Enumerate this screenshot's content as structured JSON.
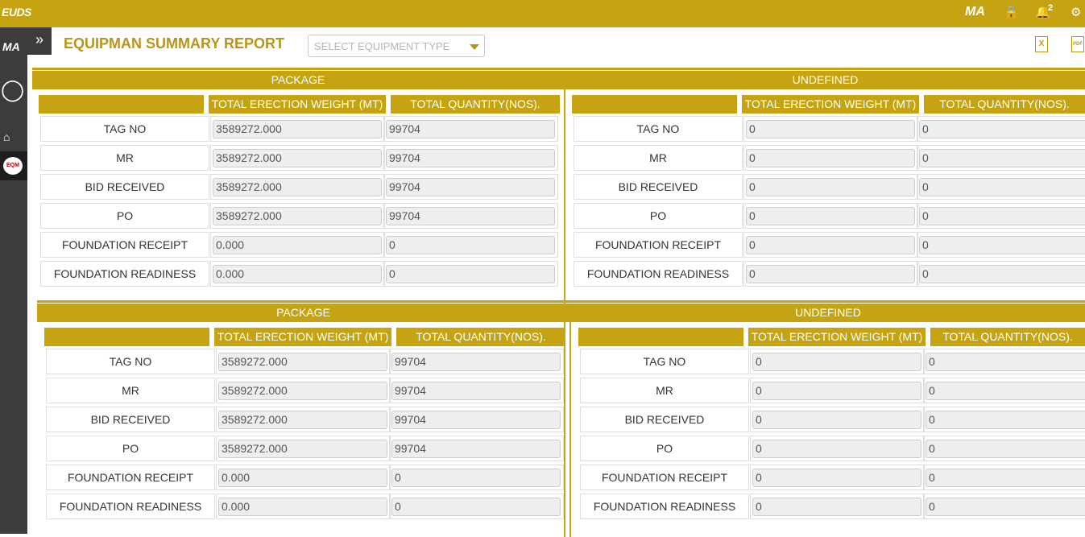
{
  "topbar": {
    "logo": "EUDS",
    "user_logo": "MA",
    "notification_count": "2"
  },
  "sidebar": {
    "logo": "MA",
    "toggle": "»",
    "eqm_badge": "EQM",
    "headset": "?"
  },
  "page": {
    "title": "EQUIPMAN SUMMARY REPORT",
    "select_placeholder": "SELECT EQUIPMENT TYPE",
    "excel_icon": "X",
    "pdf_icon": "PDF"
  },
  "colors": {
    "accent": "#c6a411",
    "title": "#b8941a",
    "sidebar": "#3c3c3c"
  },
  "blocks": [
    {
      "left": {
        "section_title": "PACKAGE",
        "col_weight": "TOTAL ERECTION WEIGHT (MT)",
        "col_qty": "TOTAL QUANTITY(NOS).",
        "rows": [
          {
            "label": "TAG NO",
            "weight": "3589272.000",
            "qty": "99704"
          },
          {
            "label": "MR",
            "weight": "3589272.000",
            "qty": "99704"
          },
          {
            "label": "BID RECEIVED",
            "weight": "3589272.000",
            "qty": "99704"
          },
          {
            "label": "PO",
            "weight": "3589272.000",
            "qty": "99704"
          },
          {
            "label": "FOUNDATION RECEIPT",
            "weight": "0.000",
            "qty": "0"
          },
          {
            "label": "FOUNDATION READINESS",
            "weight": "0.000",
            "qty": "0"
          }
        ]
      },
      "right": {
        "section_title": "UNDEFINED",
        "col_weight": "TOTAL ERECTION WEIGHT (MT)",
        "col_qty": "TOTAL QUANTITY(NOS).",
        "rows": [
          {
            "label": "TAG NO",
            "weight": "0",
            "qty": "0"
          },
          {
            "label": "MR",
            "weight": "0",
            "qty": "0"
          },
          {
            "label": "BID RECEIVED",
            "weight": "0",
            "qty": "0"
          },
          {
            "label": "PO",
            "weight": "0",
            "qty": "0"
          },
          {
            "label": "FOUNDATION RECEIPT",
            "weight": "0",
            "qty": "0"
          },
          {
            "label": "FOUNDATION READINESS",
            "weight": "0",
            "qty": "0"
          }
        ]
      }
    },
    {
      "left": {
        "section_title": "PACKAGE",
        "col_weight": "TOTAL ERECTION WEIGHT (MT)",
        "col_qty": "TOTAL QUANTITY(NOS).",
        "rows": [
          {
            "label": "TAG NO",
            "weight": "3589272.000",
            "qty": "99704"
          },
          {
            "label": "MR",
            "weight": "3589272.000",
            "qty": "99704"
          },
          {
            "label": "BID RECEIVED",
            "weight": "3589272.000",
            "qty": "99704"
          },
          {
            "label": "PO",
            "weight": "3589272.000",
            "qty": "99704"
          },
          {
            "label": "FOUNDATION RECEIPT",
            "weight": "0.000",
            "qty": "0"
          },
          {
            "label": "FOUNDATION READINESS",
            "weight": "0.000",
            "qty": "0"
          }
        ]
      },
      "right": {
        "section_title": "UNDEFINED",
        "col_weight": "TOTAL ERECTION WEIGHT (MT)",
        "col_qty": "TOTAL QUANTITY(NOS).",
        "rows": [
          {
            "label": "TAG NO",
            "weight": "0",
            "qty": "0"
          },
          {
            "label": "MR",
            "weight": "0",
            "qty": "0"
          },
          {
            "label": "BID RECEIVED",
            "weight": "0",
            "qty": "0"
          },
          {
            "label": "PO",
            "weight": "0",
            "qty": "0"
          },
          {
            "label": "FOUNDATION RECEIPT",
            "weight": "0",
            "qty": "0"
          },
          {
            "label": "FOUNDATION READINESS",
            "weight": "0",
            "qty": "0"
          }
        ]
      }
    }
  ]
}
